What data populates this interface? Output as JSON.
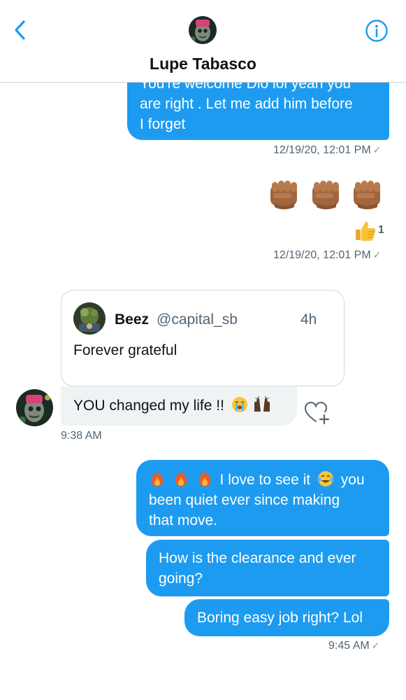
{
  "header": {
    "title": "Lupe Tabasco",
    "back_icon": "chevron-left-icon",
    "info_icon": "info-circle-icon"
  },
  "messages": {
    "m1_line1": "You're welcome Dio lol yeah you",
    "m1_line2": "are right . Let me add him before",
    "m1_line3": "I forget",
    "m1_time": "12/19/20, 12:01 PM",
    "m2_time": "12/19/20, 12:01 PM",
    "m2_reaction_count": "1",
    "quote": {
      "name": "Beez",
      "handle": "@capital_sb",
      "time": "4h",
      "text": "Forever grateful"
    },
    "in_text": "YOU changed my life !!",
    "in_time": "9:38 AM",
    "o1_line1": "I love to see it",
    "o1_line1b": "you",
    "o1_line2": "been quiet ever since making",
    "o1_line3": "that move.",
    "o2_line1": "How is the clearance and ever",
    "o2_line2": "going?",
    "o3": "Boring easy job right? Lol",
    "o_time": "9:45 AM"
  },
  "colors": {
    "accent": "#1d9bf0",
    "incoming_bubble": "#eff3f4",
    "secondary_text": "#536471"
  }
}
